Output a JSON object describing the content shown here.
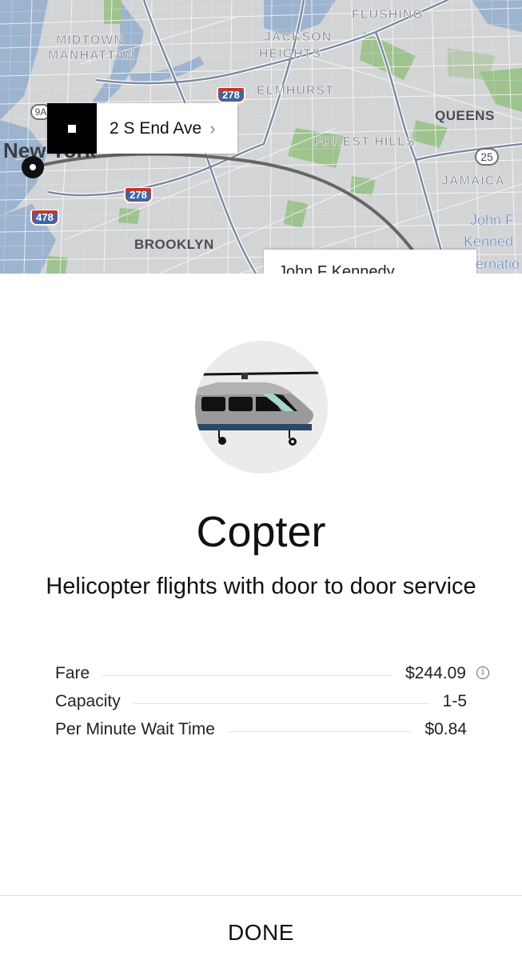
{
  "map": {
    "labels": {
      "flushing": "FLUSHING",
      "midtown": "MIDTOWN",
      "manhattan": "MANHATTAN",
      "jackson": "JACKSON",
      "heights": "HEIGHTS",
      "elmhurst": "ELMHURST",
      "queens": "QUEENS",
      "forest_hills": "FOREST HILLS",
      "jamaica": "JAMAICA",
      "brooklyn": "BROOKLYN",
      "new_york": "New York",
      "jfk_1": "John F",
      "jfk_2": "Kenned",
      "jfk_3": "ernatio"
    },
    "shields": {
      "i278_top": "278",
      "i278_mid": "278",
      "i478": "478",
      "route9a": "9A",
      "route25": "25"
    },
    "pickup": {
      "address": "2 S End Ave",
      "chevron": "›"
    },
    "destination": {
      "label": "John F Kennedy"
    },
    "colors": {
      "land": "#d3d4d6",
      "water": "#9db4cf",
      "park": "#9ec38e",
      "route": "#666666"
    }
  },
  "product": {
    "icon": "helicopter-icon",
    "name": "Copter",
    "description": "Helicopter flights with door to door service"
  },
  "details": {
    "fare_label": "Fare",
    "fare_value": "$244.09",
    "fare_info_icon": "info-icon",
    "capacity_label": "Capacity",
    "capacity_value": "1-5",
    "wait_label": "Per Minute Wait Time",
    "wait_value": "$0.84"
  },
  "footer": {
    "done_label": "DONE"
  }
}
